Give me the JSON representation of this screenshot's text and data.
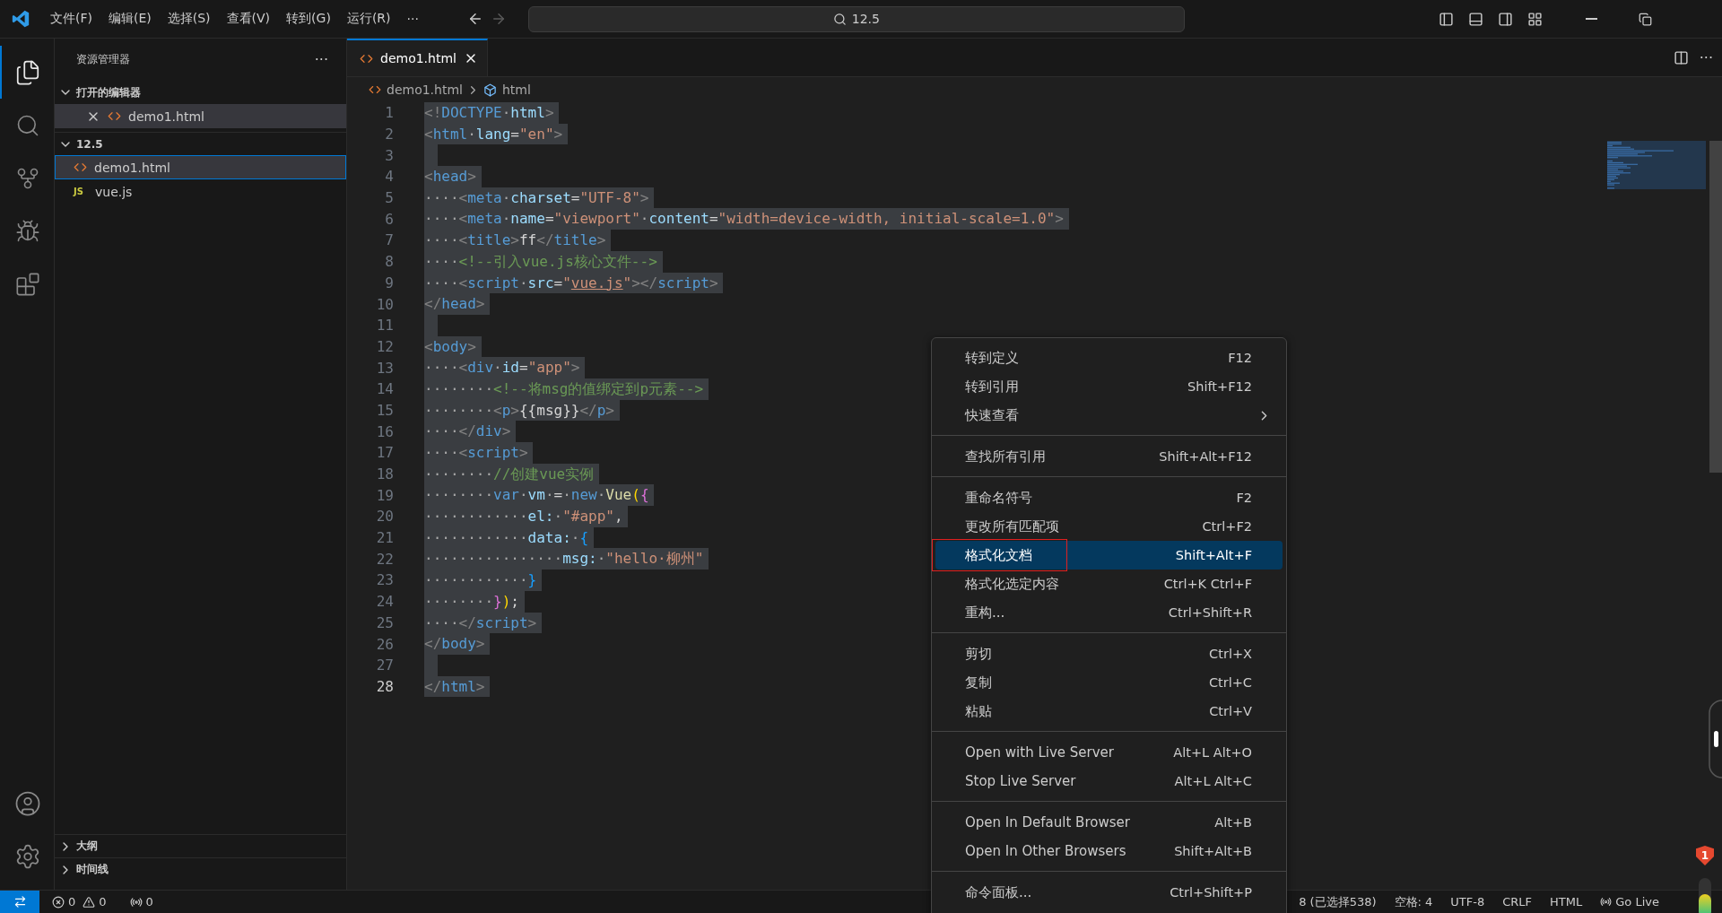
{
  "title_bar": {
    "menus": [
      "文件(F)",
      "编辑(E)",
      "选择(S)",
      "查看(V)",
      "转到(G)",
      "运行(R)"
    ],
    "more": "···",
    "command_center": "12.5"
  },
  "activity_bar": {
    "items": [
      {
        "kind": "explorer",
        "selected": true
      },
      {
        "kind": "search",
        "selected": false
      },
      {
        "kind": "source-control",
        "selected": false
      },
      {
        "kind": "run-debug",
        "selected": false
      },
      {
        "kind": "extensions",
        "selected": false
      }
    ],
    "bottom_items": [
      {
        "kind": "account",
        "selected": false
      },
      {
        "kind": "manage",
        "selected": false
      }
    ]
  },
  "sidebar": {
    "title": "资源管理器",
    "more": "···",
    "sections": [
      {
        "title": "打开的编辑器",
        "kind": "open-editors",
        "expanded": true,
        "items": [
          {
            "name": "demo1.html",
            "kind": "html",
            "selected": true,
            "focused": false
          }
        ]
      },
      {
        "title": "12.5",
        "kind": "folder",
        "expanded": true,
        "items": [
          {
            "name": "demo1.html",
            "kind": "html",
            "selected": true,
            "focused": true
          },
          {
            "name": "vue.js",
            "kind": "js",
            "badge": "JS",
            "selected": false,
            "focused": false
          }
        ]
      }
    ],
    "bottom_sections": [
      {
        "title": "大纲",
        "expanded": false
      },
      {
        "title": "时间线",
        "expanded": false
      }
    ]
  },
  "editor": {
    "tabs": [
      {
        "label": "demo1.html",
        "selected": true
      }
    ],
    "more": "···",
    "breadcrumb": [
      {
        "label": "demo1.html",
        "kind": "file"
      },
      {
        "label": "html",
        "kind": "symbol"
      }
    ],
    "lines": [
      {
        "number": "1",
        "current": false,
        "tokens": [
          {
            "kind": "p",
            "text": "<!"
          },
          {
            "kind": "tag",
            "text": "DOCTYPE"
          },
          {
            "kind": "ws",
            "text": "·"
          },
          {
            "kind": "attr",
            "text": "html"
          },
          {
            "kind": "p",
            "text": ">"
          }
        ]
      },
      {
        "number": "2",
        "current": false,
        "tokens": [
          {
            "kind": "p",
            "text": "<"
          },
          {
            "kind": "tag",
            "text": "html"
          },
          {
            "kind": "ws",
            "text": "·"
          },
          {
            "kind": "attr",
            "text": "lang"
          },
          {
            "kind": "txt",
            "text": "="
          },
          {
            "kind": "str",
            "text": "\"en\""
          },
          {
            "kind": "p",
            "text": ">"
          }
        ]
      },
      {
        "number": "3",
        "current": false
      },
      {
        "number": "4",
        "current": false,
        "tokens": [
          {
            "kind": "p",
            "text": "<"
          },
          {
            "kind": "tag",
            "text": "head"
          },
          {
            "kind": "p",
            "text": ">"
          }
        ]
      },
      {
        "number": "5",
        "current": false,
        "tokens": [
          {
            "kind": "ws",
            "text": "····"
          },
          {
            "kind": "p",
            "text": "<"
          },
          {
            "kind": "tag",
            "text": "meta"
          },
          {
            "kind": "ws",
            "text": "·"
          },
          {
            "kind": "attr",
            "text": "charset"
          },
          {
            "kind": "txt",
            "text": "="
          },
          {
            "kind": "str",
            "text": "\"UTF-8\""
          },
          {
            "kind": "p",
            "text": ">"
          }
        ]
      },
      {
        "number": "6",
        "current": false,
        "tokens": [
          {
            "kind": "ws",
            "text": "····"
          },
          {
            "kind": "p",
            "text": "<"
          },
          {
            "kind": "tag",
            "text": "meta"
          },
          {
            "kind": "ws",
            "text": "·"
          },
          {
            "kind": "attr",
            "text": "name"
          },
          {
            "kind": "txt",
            "text": "="
          },
          {
            "kind": "str",
            "text": "\"viewport\""
          },
          {
            "kind": "ws",
            "text": "·"
          },
          {
            "kind": "attr",
            "text": "content"
          },
          {
            "kind": "txt",
            "text": "="
          },
          {
            "kind": "str",
            "text": "\"width=device-width, initial-scale=1.0\""
          },
          {
            "kind": "p",
            "text": ">"
          }
        ]
      },
      {
        "number": "7",
        "current": false,
        "tokens": [
          {
            "kind": "ws",
            "text": "····"
          },
          {
            "kind": "p",
            "text": "<"
          },
          {
            "kind": "tag",
            "text": "title"
          },
          {
            "kind": "p",
            "text": ">"
          },
          {
            "kind": "txt",
            "text": "ff"
          },
          {
            "kind": "p",
            "text": "</"
          },
          {
            "kind": "tag",
            "text": "title"
          },
          {
            "kind": "p",
            "text": ">"
          }
        ]
      },
      {
        "number": "8",
        "current": false,
        "tokens": [
          {
            "kind": "ws",
            "text": "····"
          },
          {
            "kind": "cm",
            "text": "<!--引入vue.js核心文件-->"
          }
        ]
      },
      {
        "number": "9",
        "current": false,
        "tokens": [
          {
            "kind": "ws",
            "text": "····"
          },
          {
            "kind": "p",
            "text": "<"
          },
          {
            "kind": "tag",
            "text": "script"
          },
          {
            "kind": "ws",
            "text": "·"
          },
          {
            "kind": "attr",
            "text": "src"
          },
          {
            "kind": "txt",
            "text": "="
          },
          {
            "kind": "str",
            "text": "\""
          },
          {
            "kind": "link",
            "text": "vue.js"
          },
          {
            "kind": "str",
            "text": "\""
          },
          {
            "kind": "p",
            "text": "></"
          },
          {
            "kind": "tag",
            "text": "script"
          },
          {
            "kind": "p",
            "text": ">"
          }
        ]
      },
      {
        "number": "10",
        "current": false,
        "tokens": [
          {
            "kind": "p",
            "text": "</"
          },
          {
            "kind": "tag",
            "text": "head"
          },
          {
            "kind": "p",
            "text": ">"
          }
        ]
      },
      {
        "number": "11",
        "current": false
      },
      {
        "number": "12",
        "current": false,
        "tokens": [
          {
            "kind": "p",
            "text": "<"
          },
          {
            "kind": "tag",
            "text": "body"
          },
          {
            "kind": "p",
            "text": ">"
          }
        ]
      },
      {
        "number": "13",
        "current": false,
        "tokens": [
          {
            "kind": "ws",
            "text": "····"
          },
          {
            "kind": "p",
            "text": "<"
          },
          {
            "kind": "tag",
            "text": "div"
          },
          {
            "kind": "ws",
            "text": "·"
          },
          {
            "kind": "attr",
            "text": "id"
          },
          {
            "kind": "txt",
            "text": "="
          },
          {
            "kind": "str",
            "text": "\"app\""
          },
          {
            "kind": "p",
            "text": ">"
          }
        ]
      },
      {
        "number": "14",
        "current": false,
        "tokens": [
          {
            "kind": "ws",
            "text": "········"
          },
          {
            "kind": "cm",
            "text": "<!--将msg的值绑定到p元素-->"
          }
        ]
      },
      {
        "number": "15",
        "current": false,
        "tokens": [
          {
            "kind": "ws",
            "text": "········"
          },
          {
            "kind": "p",
            "text": "<"
          },
          {
            "kind": "tag",
            "text": "p"
          },
          {
            "kind": "p",
            "text": ">"
          },
          {
            "kind": "txt",
            "text": "{{msg}}"
          },
          {
            "kind": "p",
            "text": "</"
          },
          {
            "kind": "tag",
            "text": "p"
          },
          {
            "kind": "p",
            "text": ">"
          }
        ]
      },
      {
        "number": "16",
        "current": false,
        "tokens": [
          {
            "kind": "ws",
            "text": "····"
          },
          {
            "kind": "p",
            "text": "</"
          },
          {
            "kind": "tag",
            "text": "div"
          },
          {
            "kind": "p",
            "text": ">"
          }
        ]
      },
      {
        "number": "17",
        "current": false,
        "tokens": [
          {
            "kind": "ws",
            "text": "····"
          },
          {
            "kind": "p",
            "text": "<"
          },
          {
            "kind": "tag",
            "text": "script"
          },
          {
            "kind": "p",
            "text": ">"
          }
        ]
      },
      {
        "number": "18",
        "current": false,
        "tokens": [
          {
            "kind": "ws",
            "text": "········"
          },
          {
            "kind": "cm",
            "text": "//创建vue实例"
          }
        ]
      },
      {
        "number": "19",
        "current": false,
        "tokens": [
          {
            "kind": "ws",
            "text": "········"
          },
          {
            "kind": "kw",
            "text": "var"
          },
          {
            "kind": "ws",
            "text": "·"
          },
          {
            "kind": "var",
            "text": "vm"
          },
          {
            "kind": "ws",
            "text": "·"
          },
          {
            "kind": "txt",
            "text": "="
          },
          {
            "kind": "ws",
            "text": "·"
          },
          {
            "kind": "kw",
            "text": "new"
          },
          {
            "kind": "ws",
            "text": "·"
          },
          {
            "kind": "fn",
            "text": "Vue"
          },
          {
            "kind": "b1",
            "text": "("
          },
          {
            "kind": "b2",
            "text": "{"
          }
        ]
      },
      {
        "number": "20",
        "current": false,
        "tokens": [
          {
            "kind": "ws",
            "text": "············"
          },
          {
            "kind": "var",
            "text": "el:"
          },
          {
            "kind": "ws",
            "text": "·"
          },
          {
            "kind": "str",
            "text": "\"#app\""
          },
          {
            "kind": "txt",
            "text": ","
          }
        ]
      },
      {
        "number": "21",
        "current": false,
        "tokens": [
          {
            "kind": "ws",
            "text": "············"
          },
          {
            "kind": "var",
            "text": "data:"
          },
          {
            "kind": "ws",
            "text": "·"
          },
          {
            "kind": "b3",
            "text": "{"
          }
        ]
      },
      {
        "number": "22",
        "current": false,
        "tokens": [
          {
            "kind": "ws",
            "text": "················"
          },
          {
            "kind": "var",
            "text": "msg:"
          },
          {
            "kind": "ws",
            "text": "·"
          },
          {
            "kind": "str",
            "text": "\"hello·柳州\""
          }
        ]
      },
      {
        "number": "23",
        "current": false,
        "tokens": [
          {
            "kind": "ws",
            "text": "············"
          },
          {
            "kind": "b3",
            "text": "}"
          }
        ]
      },
      {
        "number": "24",
        "current": false,
        "tokens": [
          {
            "kind": "ws",
            "text": "········"
          },
          {
            "kind": "b2",
            "text": "}"
          },
          {
            "kind": "b1",
            "text": ")"
          },
          {
            "kind": "txt",
            "text": ";"
          }
        ]
      },
      {
        "number": "25",
        "current": false,
        "tokens": [
          {
            "kind": "ws",
            "text": "····"
          },
          {
            "kind": "p",
            "text": "</"
          },
          {
            "kind": "tag",
            "text": "script"
          },
          {
            "kind": "p",
            "text": ">"
          }
        ]
      },
      {
        "number": "26",
        "current": false,
        "tokens": [
          {
            "kind": "p",
            "text": "</"
          },
          {
            "kind": "tag",
            "text": "body"
          },
          {
            "kind": "p",
            "text": ">"
          }
        ]
      },
      {
        "number": "27",
        "current": false
      },
      {
        "number": "28",
        "current": true,
        "tokens": [
          {
            "kind": "p",
            "text": "</"
          },
          {
            "kind": "tag",
            "text": "html"
          },
          {
            "kind": "p",
            "text": ">"
          }
        ]
      }
    ]
  },
  "context_menu": {
    "groups": [
      [
        {
          "label": "转到定义",
          "shortcut": "F12",
          "selected": false,
          "outlined": false,
          "submenu": false
        },
        {
          "label": "转到引用",
          "shortcut": "Shift+F12",
          "selected": false,
          "outlined": false,
          "submenu": false
        },
        {
          "label": "快速查看",
          "selected": false,
          "outlined": false,
          "submenu": true
        }
      ],
      [
        {
          "label": "查找所有引用",
          "shortcut": "Shift+Alt+F12",
          "selected": false,
          "outlined": false,
          "submenu": false
        }
      ],
      [
        {
          "label": "重命名符号",
          "shortcut": "F2",
          "selected": false,
          "outlined": false,
          "submenu": false
        },
        {
          "label": "更改所有匹配项",
          "shortcut": "Ctrl+F2",
          "selected": false,
          "outlined": false,
          "submenu": false
        },
        {
          "label": "格式化文档",
          "shortcut": "Shift+Alt+F",
          "selected": true,
          "outlined": true,
          "submenu": false
        },
        {
          "label": "格式化选定内容",
          "shortcut": "Ctrl+K Ctrl+F",
          "selected": false,
          "outlined": false,
          "submenu": false
        },
        {
          "label": "重构...",
          "shortcut": "Ctrl+Shift+R",
          "selected": false,
          "outlined": false,
          "submenu": false
        }
      ],
      [
        {
          "label": "剪切",
          "shortcut": "Ctrl+X",
          "selected": false,
          "outlined": false,
          "submenu": false
        },
        {
          "label": "复制",
          "shortcut": "Ctrl+C",
          "selected": false,
          "outlined": false,
          "submenu": false
        },
        {
          "label": "粘贴",
          "shortcut": "Ctrl+V",
          "selected": false,
          "outlined": false,
          "submenu": false
        }
      ],
      [
        {
          "label": "Open with Live Server",
          "shortcut": "Alt+L Alt+O",
          "selected": false,
          "outlined": false,
          "submenu": false
        },
        {
          "label": "Stop Live Server",
          "shortcut": "Alt+L Alt+C",
          "selected": false,
          "outlined": false,
          "submenu": false
        }
      ],
      [
        {
          "label": "Open In Default Browser",
          "shortcut": "Alt+B",
          "selected": false,
          "outlined": false,
          "submenu": false
        },
        {
          "label": "Open In Other Browsers",
          "shortcut": "Shift+Alt+B",
          "selected": false,
          "outlined": false,
          "submenu": false
        }
      ],
      [
        {
          "label": "命令面板...",
          "shortcut": "Ctrl+Shift+P",
          "selected": false,
          "outlined": false,
          "submenu": false
        }
      ]
    ]
  },
  "status_bar": {
    "errors": "0",
    "warnings": "0",
    "ports": "0",
    "right": [
      {
        "kind": "selection",
        "text": "8 (已选择538)"
      },
      {
        "kind": "indent",
        "text": "空格: 4"
      },
      {
        "kind": "encoding",
        "text": "UTF-8"
      },
      {
        "kind": "eol",
        "text": "CRLF"
      },
      {
        "kind": "language",
        "text": "HTML"
      },
      {
        "kind": "golive",
        "text": "Go Live"
      }
    ]
  },
  "widget": {
    "badge": "1"
  }
}
